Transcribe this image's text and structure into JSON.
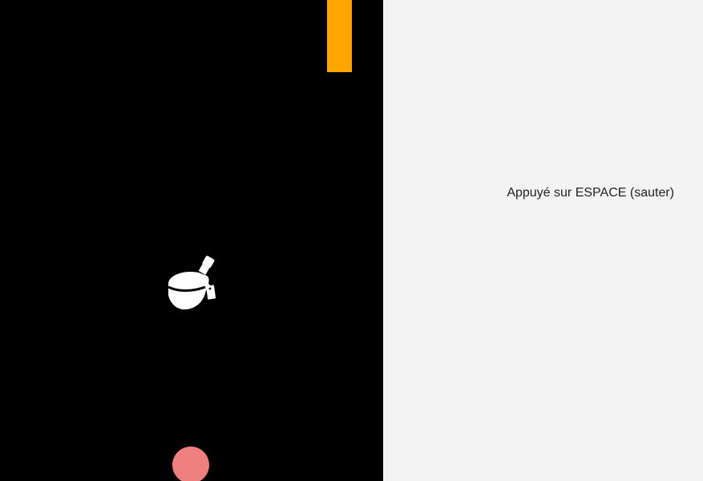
{
  "game": {
    "background_color": "#000000",
    "obstacle_color": "#ffa500",
    "player_color": "#f08080",
    "item_icon": "potion-bottle-icon"
  },
  "sidebar": {
    "background_color": "#f3f3f3",
    "instruction": "Appuyé sur ESPACE (sauter)"
  }
}
